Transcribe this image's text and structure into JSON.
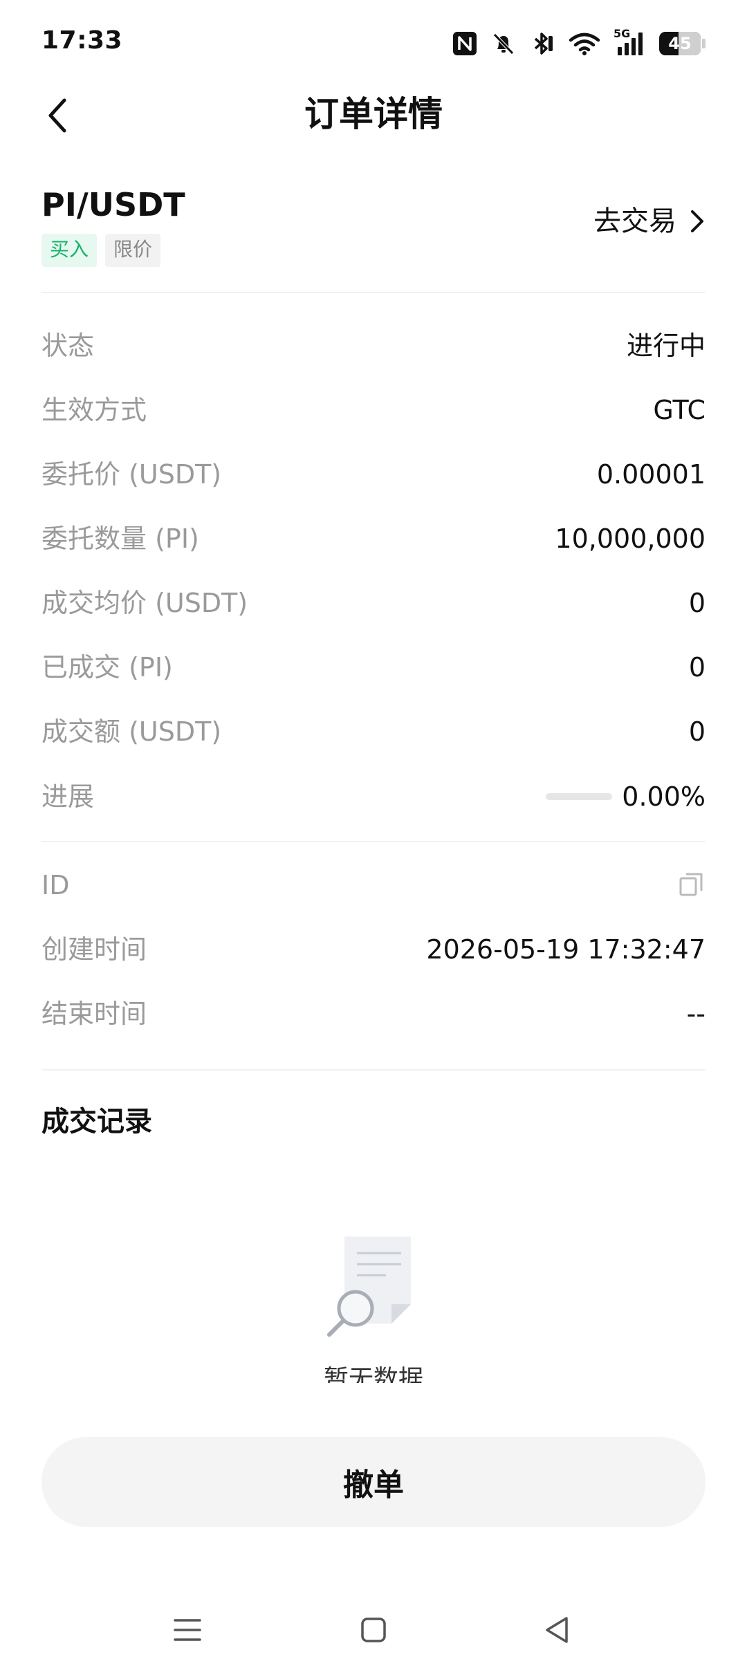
{
  "status_bar": {
    "time": "17:33",
    "network": "5G",
    "battery": "45",
    "icons": [
      "nfc-icon",
      "mute-icon",
      "bluetooth-icon",
      "wifi-icon",
      "signal-icon",
      "battery-icon"
    ]
  },
  "header": {
    "title": "订单详情",
    "back_icon": "chevron-left-icon"
  },
  "pair": {
    "name": "PI/USDT",
    "tags": [
      "买入",
      "限价"
    ],
    "go_trade": "去交易",
    "colors": {
      "buy": "#17b26a",
      "buy_bg": "#e6f8ef"
    }
  },
  "details": [
    {
      "label": "状态",
      "value": "进行中"
    },
    {
      "label": "生效方式",
      "value": "GTC"
    },
    {
      "label": "委托价 (USDT)",
      "value": "0.00001"
    },
    {
      "label": "委托数量 (PI)",
      "value": "10,000,000"
    },
    {
      "label": "成交均价 (USDT)",
      "value": "0"
    },
    {
      "label": "已成交 (PI)",
      "value": "0"
    },
    {
      "label": "成交额 (USDT)",
      "value": "0"
    },
    {
      "label": "进展",
      "value": "0.00%",
      "progress": 0
    }
  ],
  "meta": [
    {
      "label": "ID",
      "value": ""
    },
    {
      "label": "创建时间",
      "value": "2026-05-19 17:32:47"
    },
    {
      "label": "结束时间",
      "value": "--"
    }
  ],
  "trade_records": {
    "title": "成交记录",
    "empty_text": "暂无数据"
  },
  "cancel_button": "撤单",
  "nav_bar": [
    "menu-icon",
    "home-icon",
    "back-triangle-icon"
  ]
}
